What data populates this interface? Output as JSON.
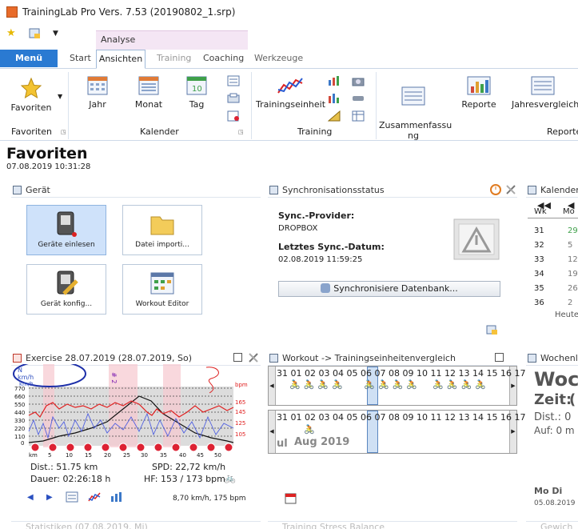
{
  "window": {
    "title": "TrainingLab Pro Vers. 7.53 (20190802_1.srp)"
  },
  "context_tab": "Analyse",
  "menu_label": "Menü",
  "tabs": [
    "Start",
    "Ansichten",
    "Training",
    "Coaching",
    "Werkzeuge"
  ],
  "ribbon": {
    "favoriten": "Favoriten",
    "jahr": "Jahr",
    "monat": "Monat",
    "tag": "Tag",
    "trainingseinheit": "Trainingseinheit",
    "zusammenfassung": "Zusammenfassu\nng",
    "reporte": "Reporte",
    "jahresvergleich": "Jahresvergleich",
    "groups": {
      "favoriten": "Favoriten",
      "kalender": "Kalender",
      "training": "Training",
      "reporte": "Reporte"
    }
  },
  "page": {
    "title": "Favoriten",
    "date": "07.08.2019 10:31:28"
  },
  "geraet": {
    "title": "Gerät",
    "tiles": [
      "Geräte einlesen",
      "Datei importi...",
      "Gerät konfig...",
      "Workout Editor"
    ]
  },
  "sync": {
    "title": "Synchronisationsstatus",
    "provider_label": "Sync.-Provider:",
    "provider": "DROPBOX",
    "last_label": "Letztes Sync.-Datum:",
    "last": "02.08.2019 11:59:25",
    "button": "Synchronisiere Datenbank..."
  },
  "kalender": {
    "title": "Kalender",
    "wk_label": "Wk",
    "mo_label": "Mo",
    "weeks": [
      "31",
      "32",
      "33",
      "34",
      "35",
      "36"
    ],
    "days": [
      "29",
      "5",
      "12",
      "19",
      "26",
      "2"
    ],
    "today": "Heute"
  },
  "exercise": {
    "title": "Exercise 28.07.2019 (28.07.2019, So)",
    "y_labels": [
      "770",
      "660",
      "550",
      "440",
      "330",
      "220",
      "110",
      "0"
    ],
    "x_labels": [
      "km",
      "5",
      "10",
      "15",
      "20",
      "25",
      "30",
      "35",
      "40",
      "45",
      "50"
    ],
    "right_labels": [
      "bpm",
      "165",
      "145",
      "125",
      "105"
    ],
    "unit_n": "N",
    "unit_kmh": "km/h",
    "unit_kmh2": "km/h",
    "marker": "# 2",
    "dist": "Dist.: 51.75 km",
    "spd": "SPD: 22,72 km/h",
    "dauer": "Dauer: 02:26:18 h",
    "hf": "HF: 153 / 173 bpm",
    "footer": "8,70 km/h, 175 bpm"
  },
  "workout": {
    "title": "Workout -> Trainingseinheitenvergleich",
    "row1": [
      "31",
      "01",
      "02",
      "03",
      "04",
      "05",
      "06",
      "07",
      "08",
      "09",
      "10",
      "11",
      "12",
      "13",
      "14",
      "15",
      "16",
      "17"
    ],
    "row2": [
      "31",
      "01",
      "02",
      "03",
      "04",
      "05",
      "06",
      "07",
      "08",
      "09",
      "10",
      "11",
      "12",
      "13",
      "14",
      "15",
      "16",
      "17"
    ],
    "month": "Aug 2019",
    "side": "ul"
  },
  "woche": {
    "title": "Wochenl",
    "big": "Woc",
    "zeit": "Zeit:",
    "zeit_val": "(",
    "dist": "Dist.: 0",
    "auf": "Auf: 0 m",
    "days": "Mo Di",
    "date": "05.08.2019"
  },
  "bottom": {
    "stat": "Statistiken (07.08.2019, Mi)",
    "tsb": "Training Stress Balance",
    "gew": "Gewich"
  },
  "colors": {
    "accent": "#2a7ad2",
    "context": "#f4e6f4",
    "hr": "#e02020",
    "speed": "#5060e0",
    "alt": "#111111"
  }
}
